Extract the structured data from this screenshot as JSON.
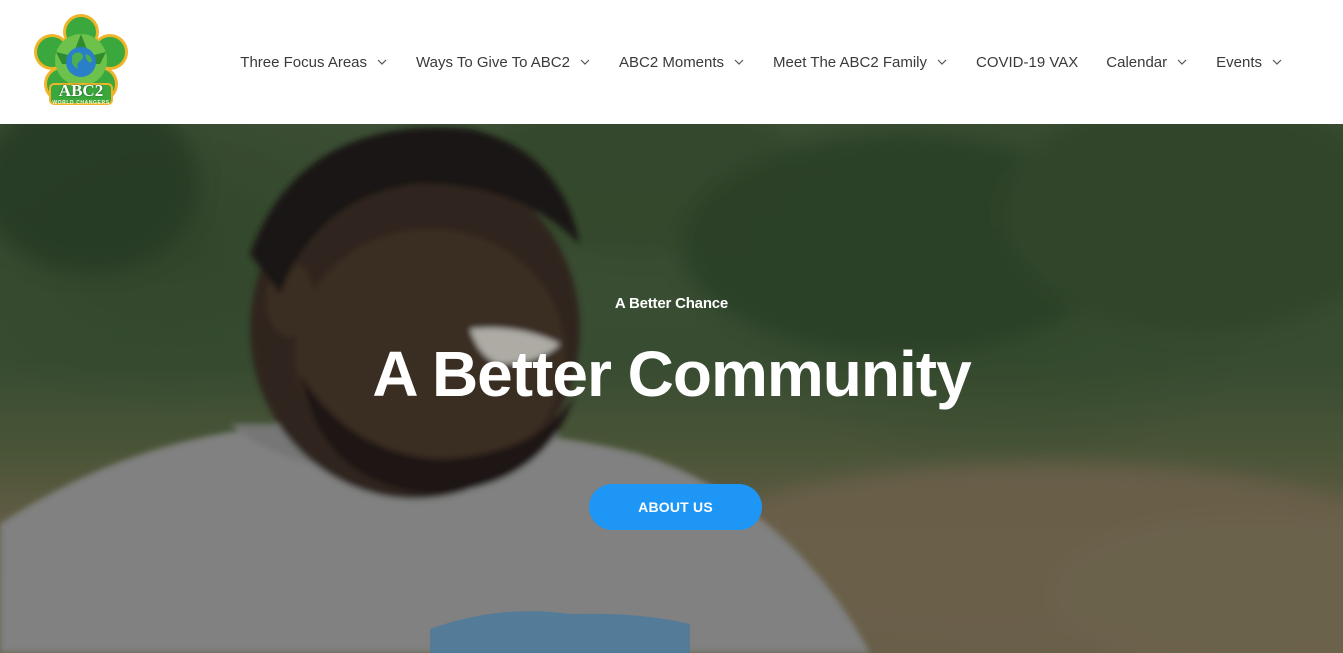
{
  "brand": {
    "logo_text": "ABC2",
    "logo_subtext": "WORLD CHANGERS"
  },
  "nav": {
    "items": [
      {
        "label": "Three Focus Areas",
        "has_dropdown": true
      },
      {
        "label": "Ways To Give To ABC2",
        "has_dropdown": true
      },
      {
        "label": "ABC2 Moments",
        "has_dropdown": true
      },
      {
        "label": "Meet The ABC2 Family",
        "has_dropdown": true
      },
      {
        "label": "COVID-19 VAX",
        "has_dropdown": false
      },
      {
        "label": "Calendar",
        "has_dropdown": true
      },
      {
        "label": "Events",
        "has_dropdown": true
      }
    ]
  },
  "hero": {
    "kicker": "A Better Chance",
    "title": "A Better Community",
    "button_label": "ABOUT US"
  },
  "colors": {
    "accent": "#1e96f5",
    "nav_text": "#3a3a3a",
    "logo_green": "#3aa83c",
    "logo_gold": "#f0b429"
  }
}
